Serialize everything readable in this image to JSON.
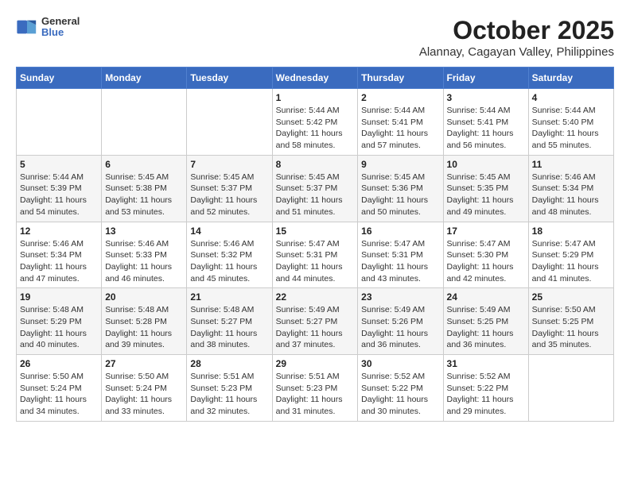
{
  "logo": {
    "line1": "General",
    "line2": "Blue"
  },
  "title": "October 2025",
  "subtitle": "Alannay, Cagayan Valley, Philippines",
  "weekdays": [
    "Sunday",
    "Monday",
    "Tuesday",
    "Wednesday",
    "Thursday",
    "Friday",
    "Saturday"
  ],
  "weeks": [
    [
      {
        "day": "",
        "info": ""
      },
      {
        "day": "",
        "info": ""
      },
      {
        "day": "",
        "info": ""
      },
      {
        "day": "1",
        "info": "Sunrise: 5:44 AM\nSunset: 5:42 PM\nDaylight: 11 hours\nand 58 minutes."
      },
      {
        "day": "2",
        "info": "Sunrise: 5:44 AM\nSunset: 5:41 PM\nDaylight: 11 hours\nand 57 minutes."
      },
      {
        "day": "3",
        "info": "Sunrise: 5:44 AM\nSunset: 5:41 PM\nDaylight: 11 hours\nand 56 minutes."
      },
      {
        "day": "4",
        "info": "Sunrise: 5:44 AM\nSunset: 5:40 PM\nDaylight: 11 hours\nand 55 minutes."
      }
    ],
    [
      {
        "day": "5",
        "info": "Sunrise: 5:44 AM\nSunset: 5:39 PM\nDaylight: 11 hours\nand 54 minutes."
      },
      {
        "day": "6",
        "info": "Sunrise: 5:45 AM\nSunset: 5:38 PM\nDaylight: 11 hours\nand 53 minutes."
      },
      {
        "day": "7",
        "info": "Sunrise: 5:45 AM\nSunset: 5:37 PM\nDaylight: 11 hours\nand 52 minutes."
      },
      {
        "day": "8",
        "info": "Sunrise: 5:45 AM\nSunset: 5:37 PM\nDaylight: 11 hours\nand 51 minutes."
      },
      {
        "day": "9",
        "info": "Sunrise: 5:45 AM\nSunset: 5:36 PM\nDaylight: 11 hours\nand 50 minutes."
      },
      {
        "day": "10",
        "info": "Sunrise: 5:45 AM\nSunset: 5:35 PM\nDaylight: 11 hours\nand 49 minutes."
      },
      {
        "day": "11",
        "info": "Sunrise: 5:46 AM\nSunset: 5:34 PM\nDaylight: 11 hours\nand 48 minutes."
      }
    ],
    [
      {
        "day": "12",
        "info": "Sunrise: 5:46 AM\nSunset: 5:34 PM\nDaylight: 11 hours\nand 47 minutes."
      },
      {
        "day": "13",
        "info": "Sunrise: 5:46 AM\nSunset: 5:33 PM\nDaylight: 11 hours\nand 46 minutes."
      },
      {
        "day": "14",
        "info": "Sunrise: 5:46 AM\nSunset: 5:32 PM\nDaylight: 11 hours\nand 45 minutes."
      },
      {
        "day": "15",
        "info": "Sunrise: 5:47 AM\nSunset: 5:31 PM\nDaylight: 11 hours\nand 44 minutes."
      },
      {
        "day": "16",
        "info": "Sunrise: 5:47 AM\nSunset: 5:31 PM\nDaylight: 11 hours\nand 43 minutes."
      },
      {
        "day": "17",
        "info": "Sunrise: 5:47 AM\nSunset: 5:30 PM\nDaylight: 11 hours\nand 42 minutes."
      },
      {
        "day": "18",
        "info": "Sunrise: 5:47 AM\nSunset: 5:29 PM\nDaylight: 11 hours\nand 41 minutes."
      }
    ],
    [
      {
        "day": "19",
        "info": "Sunrise: 5:48 AM\nSunset: 5:29 PM\nDaylight: 11 hours\nand 40 minutes."
      },
      {
        "day": "20",
        "info": "Sunrise: 5:48 AM\nSunset: 5:28 PM\nDaylight: 11 hours\nand 39 minutes."
      },
      {
        "day": "21",
        "info": "Sunrise: 5:48 AM\nSunset: 5:27 PM\nDaylight: 11 hours\nand 38 minutes."
      },
      {
        "day": "22",
        "info": "Sunrise: 5:49 AM\nSunset: 5:27 PM\nDaylight: 11 hours\nand 37 minutes."
      },
      {
        "day": "23",
        "info": "Sunrise: 5:49 AM\nSunset: 5:26 PM\nDaylight: 11 hours\nand 36 minutes."
      },
      {
        "day": "24",
        "info": "Sunrise: 5:49 AM\nSunset: 5:25 PM\nDaylight: 11 hours\nand 36 minutes."
      },
      {
        "day": "25",
        "info": "Sunrise: 5:50 AM\nSunset: 5:25 PM\nDaylight: 11 hours\nand 35 minutes."
      }
    ],
    [
      {
        "day": "26",
        "info": "Sunrise: 5:50 AM\nSunset: 5:24 PM\nDaylight: 11 hours\nand 34 minutes."
      },
      {
        "day": "27",
        "info": "Sunrise: 5:50 AM\nSunset: 5:24 PM\nDaylight: 11 hours\nand 33 minutes."
      },
      {
        "day": "28",
        "info": "Sunrise: 5:51 AM\nSunset: 5:23 PM\nDaylight: 11 hours\nand 32 minutes."
      },
      {
        "day": "29",
        "info": "Sunrise: 5:51 AM\nSunset: 5:23 PM\nDaylight: 11 hours\nand 31 minutes."
      },
      {
        "day": "30",
        "info": "Sunrise: 5:52 AM\nSunset: 5:22 PM\nDaylight: 11 hours\nand 30 minutes."
      },
      {
        "day": "31",
        "info": "Sunrise: 5:52 AM\nSunset: 5:22 PM\nDaylight: 11 hours\nand 29 minutes."
      },
      {
        "day": "",
        "info": ""
      }
    ]
  ]
}
